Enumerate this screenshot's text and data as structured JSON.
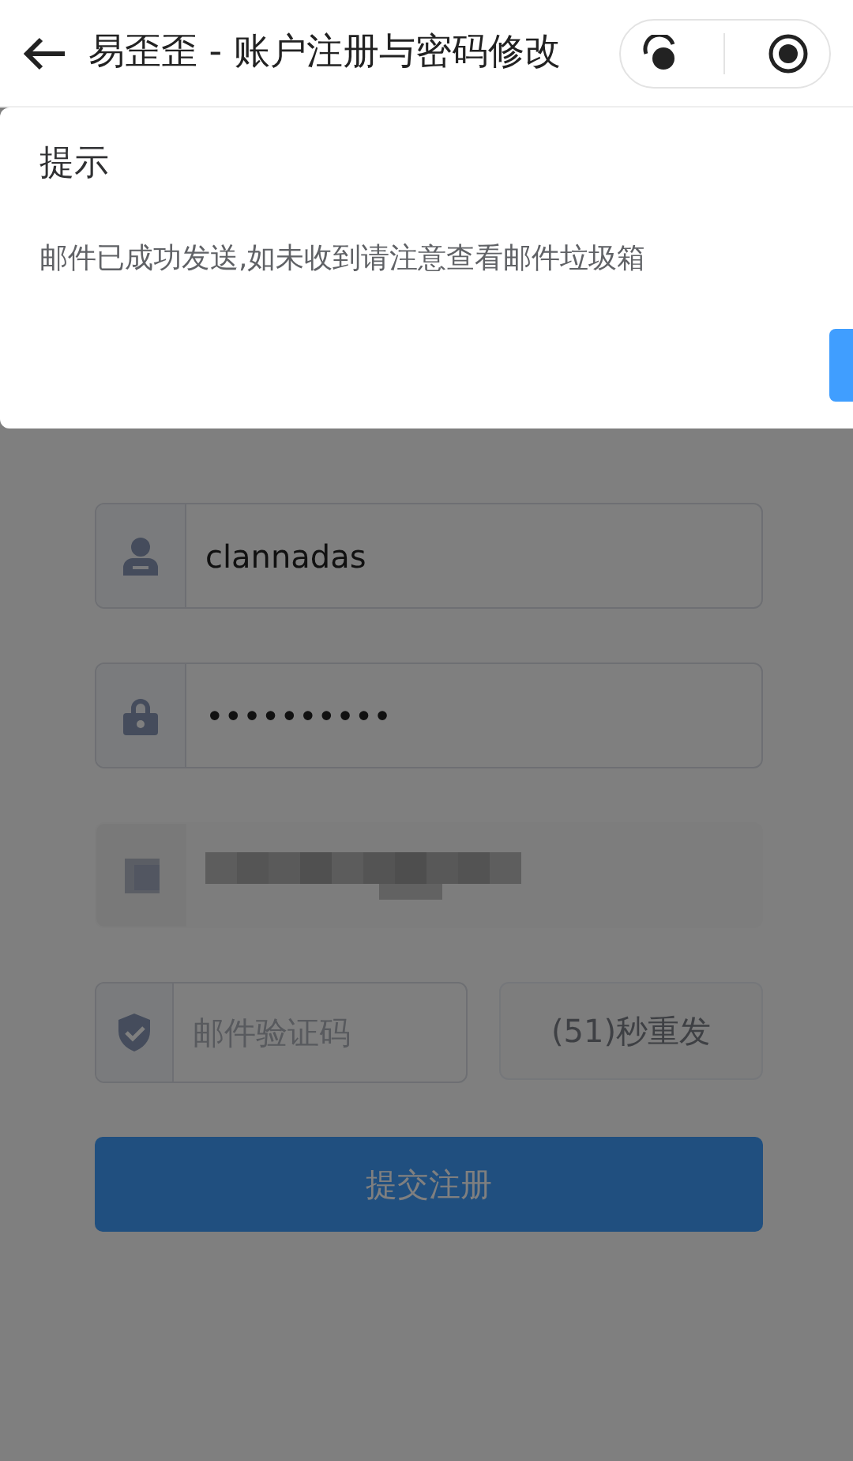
{
  "header": {
    "title": "易歪歪 - 账户注册与密码修改"
  },
  "form": {
    "fields": [
      {
        "kind": "user",
        "value": "clannadas"
      },
      {
        "kind": "password",
        "value": "••••••••••"
      },
      {
        "kind": "redacted"
      }
    ],
    "code_field": {
      "placeholder": "邮件验证码"
    },
    "resend_button": {
      "label": "(51)秒重发",
      "disabled": true
    },
    "submit_button": {
      "label": "提交注册"
    }
  },
  "dialog": {
    "title": "提示",
    "message": "邮件已成功发送,如未收到请注意查看邮件垃圾箱"
  }
}
